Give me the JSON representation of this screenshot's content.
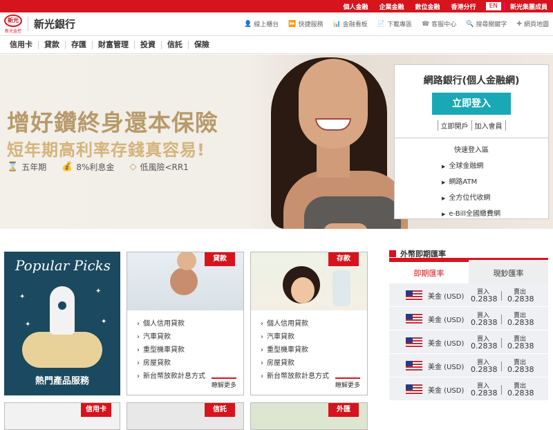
{
  "topbar": {
    "links": [
      "個人金融",
      "企業金融",
      "數位金融",
      "香港分行"
    ],
    "lang": "EN",
    "group": "新光集團成員"
  },
  "header": {
    "logo_mark": "新光",
    "logo_sub": "新光金控",
    "bank_name": "新光銀行",
    "utilities": [
      {
        "icon": "user-icon",
        "glyph": "👤",
        "label": "線上櫃台"
      },
      {
        "icon": "play-icon",
        "glyph": "⏩",
        "label": "快捷服務"
      },
      {
        "icon": "chart-icon",
        "glyph": "📊",
        "label": "金融看板"
      },
      {
        "icon": "document-icon",
        "glyph": "📄",
        "label": "下載專區"
      },
      {
        "icon": "phone-icon",
        "glyph": "☎",
        "label": "客服中心"
      },
      {
        "icon": "search-icon",
        "glyph": "🔍",
        "label": "搜尋關鍵字"
      },
      {
        "icon": "plus-icon",
        "glyph": "✚",
        "label": "網頁地圖"
      }
    ]
  },
  "nav": {
    "items": [
      "信用卡",
      "貸款",
      "存匯",
      "財富管理",
      "投資",
      "信託",
      "保險"
    ]
  },
  "banner": {
    "title": "增好鑽終身還本保險",
    "subtitle": "短年期高利率存錢真容易!",
    "features": [
      {
        "icon": "hourglass-icon",
        "glyph": "⌛",
        "text": "五年期"
      },
      {
        "icon": "moneybag-icon",
        "glyph": "💰",
        "text": "8%利息金"
      },
      {
        "icon": "diamond-icon",
        "glyph": "◇",
        "text": "低風險<RR1"
      }
    ]
  },
  "login": {
    "title": "網路銀行(個人金融網)",
    "login_button": "立即登入",
    "open_account": "立即開戶",
    "join_member": "加入會員",
    "quick_title": "快速登入區",
    "quick_items": [
      "全球金融網",
      "網路ATM",
      "全方位代收網",
      "e-Bill全國繳費網"
    ]
  },
  "popular": {
    "title": "Popular Picks",
    "label": "熱門產品服務"
  },
  "loan_tile": {
    "tag": "貸款",
    "items": [
      "個人信用貸款",
      "汽車貸款",
      "重型機車貸款",
      "房屋貸款",
      "新台幣放款計息方式"
    ],
    "more": "瞭解更多"
  },
  "deposit_tile": {
    "tag": "存款",
    "items": [
      "個人信用貸款",
      "汽車貸款",
      "重型機車貸款",
      "房屋貸款",
      "新台幣放款計息方式"
    ],
    "more": "瞭解更多"
  },
  "bottom_tiles": [
    "信用卡",
    "信託",
    "外匯"
  ],
  "fx": {
    "title": "外幣即期匯率",
    "tab_active": "即期匯率",
    "tab_inactive": "現鈔匯率",
    "rows": [
      {
        "currency": "美金 (USD)",
        "buy_label": "買入",
        "buy": "0.2838",
        "sell_label": "賣出",
        "sell": "0.2838"
      },
      {
        "currency": "美金 (USD)",
        "buy_label": "買入",
        "buy": "0.2838",
        "sell_label": "賣出",
        "sell": "0.2838"
      },
      {
        "currency": "美金 (USD)",
        "buy_label": "買入",
        "buy": "0.2838",
        "sell_label": "賣出",
        "sell": "0.2838"
      },
      {
        "currency": "美金 (USD)",
        "buy_label": "買入",
        "buy": "0.2838",
        "sell_label": "賣出",
        "sell": "0.2838"
      },
      {
        "currency": "美金 (USD)",
        "buy_label": "買入",
        "buy": "0.2838",
        "sell_label": "賣出",
        "sell": "0.2838"
      }
    ]
  },
  "colors": {
    "brand_red": "#d6141d",
    "login_teal": "#1aa8b4",
    "banner_gold": "#b79a6a"
  }
}
